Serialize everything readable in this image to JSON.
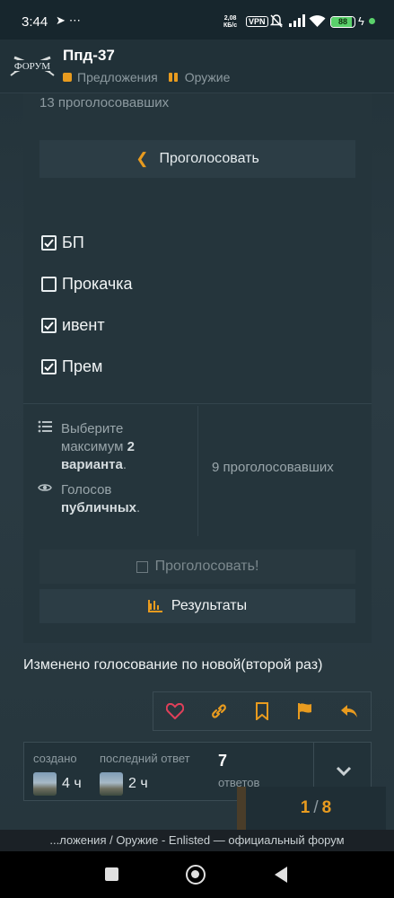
{
  "status_bar": {
    "time": "3:44",
    "left_icons": [
      "telegram-icon",
      "more-icon"
    ],
    "speed_value": "2,08",
    "speed_unit": "КБ/с",
    "vpn": "VPN",
    "battery": "88"
  },
  "header": {
    "logo_text": "ФОРУМ",
    "title": "Ппд-37",
    "crumbs": [
      {
        "label": "Предложения",
        "color": "#e89b1f"
      },
      {
        "label": "Оружие",
        "color": "#e89b1f"
      }
    ]
  },
  "poll": {
    "voters_top": "13 проголосовавших",
    "back_vote_label": "Проголосовать",
    "options": [
      {
        "label": "БП",
        "checked": true
      },
      {
        "label": "Прокачка",
        "checked": false
      },
      {
        "label": "ивент",
        "checked": true
      },
      {
        "label": "Прем",
        "checked": true
      }
    ],
    "info_choose_prefix": "Выберите",
    "info_choose_mid": "максимум",
    "info_choose_num": "2",
    "info_choose_bold": "варианта",
    "info_choose_end": ".",
    "info_public_prefix": "Голосов",
    "info_public_bold": "публичных",
    "info_public_end": ".",
    "voters_right": "9 проголосовавших",
    "vote_button": "Проголосовать!",
    "results_button": "Результаты"
  },
  "post": {
    "text": "Изменено голосование по новой(второй раз)"
  },
  "actions": [
    "heart-icon",
    "link-icon",
    "bookmark-icon",
    "flag-icon",
    "reply-icon"
  ],
  "topic_map": {
    "created_label": "создано",
    "created_value": "4 ч",
    "last_reply_label": "последний ответ",
    "last_reply_value": "2 ч",
    "replies_count": "7",
    "replies_label": "ответов"
  },
  "progress": {
    "current": "1",
    "separator": "/",
    "total": "8"
  },
  "url_bar": "...ложения / Оружие - Enlisted — официальный форум"
}
